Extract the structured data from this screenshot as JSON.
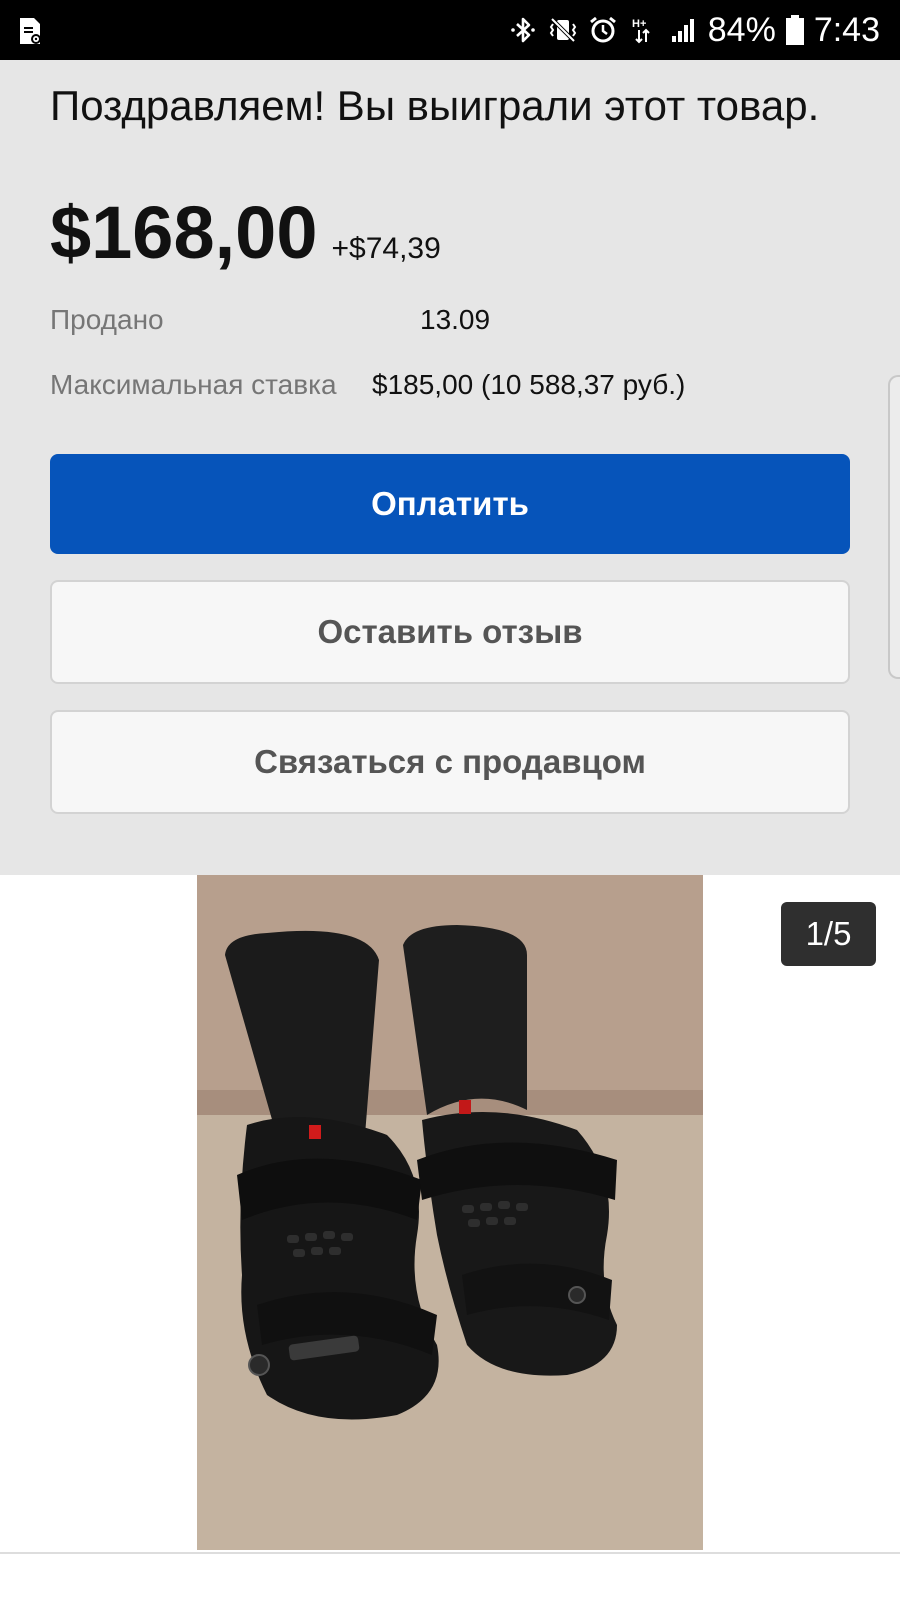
{
  "status_bar": {
    "battery": "84%",
    "time": "7:43",
    "network_label": "H+",
    "icons": [
      "sim-settings-icon",
      "bluetooth-icon",
      "vibrate-icon",
      "alarm-icon",
      "data-arrows-icon",
      "signal-icon",
      "battery-icon"
    ]
  },
  "header": {
    "title": "Поздравляем! Вы выиграли этот товар.",
    "price": "$168,00",
    "shipping": "+$74,39"
  },
  "details": {
    "sold_label": "Продано",
    "sold_value": "13.09",
    "max_bid_label": "Максимальная ставка",
    "max_bid_value": "$185,00 (10 588,37 руб.)"
  },
  "actions": {
    "pay_label": "Оплатить",
    "feedback_label": "Оставить отзыв",
    "contact_label": "Связаться с продавцом"
  },
  "gallery": {
    "counter": "1/5"
  },
  "colors": {
    "primary_button": "#0654ba",
    "panel_background": "#e6e6e6"
  }
}
